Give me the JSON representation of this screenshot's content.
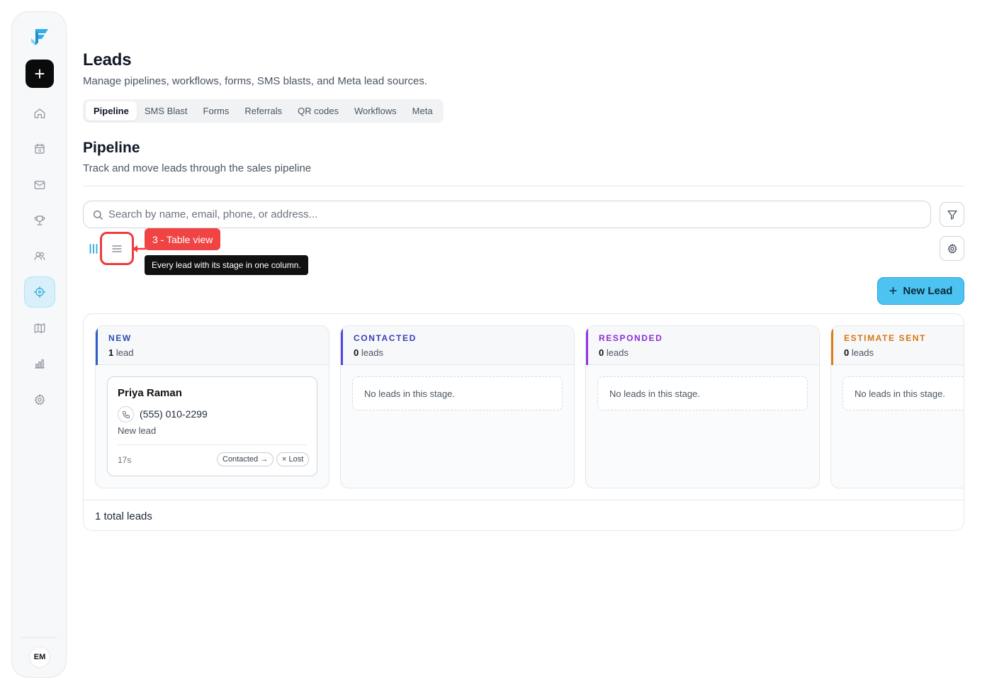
{
  "sidebar": {
    "new_button_label": "+",
    "user_initials": "EM",
    "nav_items": [
      {
        "icon": "home-icon"
      },
      {
        "icon": "calendar-icon"
      },
      {
        "icon": "mail-icon"
      },
      {
        "icon": "trophy-icon"
      },
      {
        "icon": "users-icon"
      },
      {
        "icon": "crosshair-icon",
        "active": true
      },
      {
        "icon": "map-icon"
      },
      {
        "icon": "bar-chart-icon"
      },
      {
        "icon": "gear-icon"
      }
    ]
  },
  "page": {
    "title": "Leads",
    "subtitle": "Manage pipelines, workflows, forms, SMS blasts, and Meta lead sources."
  },
  "tabs": [
    "Pipeline",
    "SMS Blast",
    "Forms",
    "Referrals",
    "QR codes",
    "Workflows",
    "Meta"
  ],
  "active_tab": "Pipeline",
  "section": {
    "title": "Pipeline",
    "subtitle": "Track and move leads through the sales pipeline"
  },
  "search": {
    "placeholder": "Search by name, email, phone, or address...",
    "value": ""
  },
  "annotation": {
    "badge": "3 - Table view",
    "tooltip": "Every lead with its stage in one column."
  },
  "new_lead_button": "New Lead",
  "columns": [
    {
      "name": "NEW",
      "count": "1",
      "count_label": "lead",
      "accent": "#2b5fce",
      "name_color": "#2b4fb0"
    },
    {
      "name": "CONTACTED",
      "count": "0",
      "count_label": "leads",
      "accent": "#4f46e5",
      "name_color": "#3f3cbb",
      "empty_text": "No leads in this stage."
    },
    {
      "name": "RESPONDED",
      "count": "0",
      "count_label": "leads",
      "accent": "#9333ea",
      "name_color": "#8a2fd6",
      "empty_text": "No leads in this stage."
    },
    {
      "name": "ESTIMATE SENT",
      "count": "0",
      "count_label": "leads",
      "accent": "#e07b12",
      "name_color": "#d9770f",
      "empty_text": "No leads in this stage."
    }
  ],
  "lead_card": {
    "name": "Priya Raman",
    "phone": "(555) 010-2299",
    "status": "New lead",
    "age": "17s",
    "actions": [
      "Contacted →",
      "× Lost"
    ]
  },
  "footer": {
    "total": "1 total leads"
  }
}
